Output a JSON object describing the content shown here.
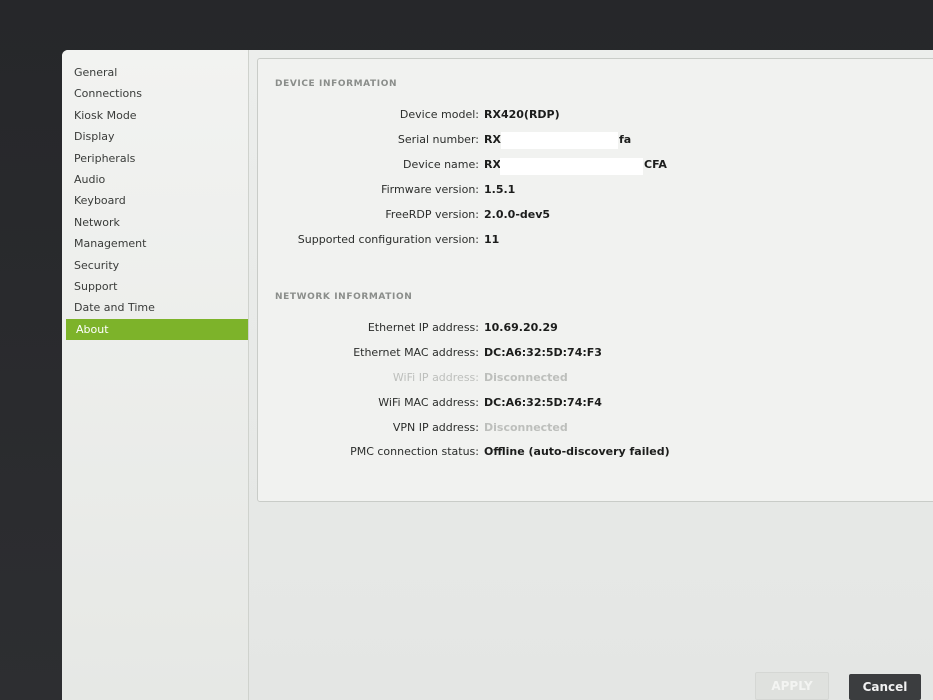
{
  "sidebar": {
    "items": [
      {
        "label": "General"
      },
      {
        "label": "Connections"
      },
      {
        "label": "Kiosk Mode"
      },
      {
        "label": "Display"
      },
      {
        "label": "Peripherals"
      },
      {
        "label": "Audio"
      },
      {
        "label": "Keyboard"
      },
      {
        "label": "Network"
      },
      {
        "label": "Management"
      },
      {
        "label": "Security"
      },
      {
        "label": "Support"
      },
      {
        "label": "Date and Time"
      },
      {
        "label": "About"
      }
    ],
    "active_index": 12,
    "active_color": "#7db32a"
  },
  "device_info": {
    "title": "DEVICE INFORMATION",
    "rows": [
      {
        "label": "Device model:",
        "value": "RX420(RDP)"
      },
      {
        "label": "Serial number:",
        "value_prefix": "RX",
        "value_suffix": "fa"
      },
      {
        "label": "Device name:",
        "value_prefix": "RX",
        "value_suffix": "CFA"
      },
      {
        "label": "Firmware version:",
        "value": "1.5.1"
      },
      {
        "label": "FreeRDP version:",
        "value": "2.0.0-dev5"
      },
      {
        "label": "Supported configuration version:",
        "value": "11"
      }
    ]
  },
  "network_info": {
    "title": "NETWORK INFORMATION",
    "rows": [
      {
        "label": "Ethernet IP address:",
        "value": "10.69.20.29"
      },
      {
        "label": "Ethernet MAC address:",
        "value": "DC:A6:32:5D:74:F3"
      },
      {
        "label": "WiFi IP address:",
        "value": "Disconnected"
      },
      {
        "label": "WiFi MAC address:",
        "value": "DC:A6:32:5D:74:F4"
      },
      {
        "label": "VPN IP address:",
        "value": "Disconnected"
      },
      {
        "label": "PMC connection status:",
        "value": "Offline (auto-discovery failed)"
      }
    ]
  },
  "buttons": {
    "apply": "APPLY",
    "cancel": "Cancel"
  }
}
